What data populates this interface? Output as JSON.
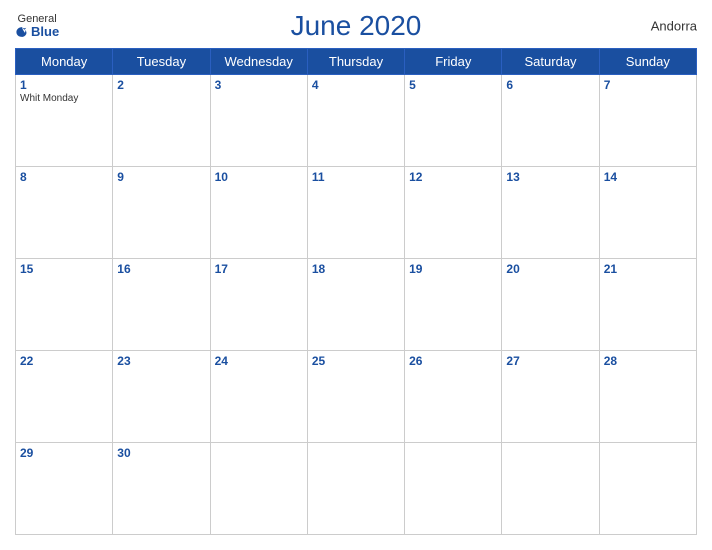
{
  "header": {
    "logo_general": "General",
    "logo_blue": "Blue",
    "title": "June 2020",
    "country": "Andorra"
  },
  "weekdays": [
    "Monday",
    "Tuesday",
    "Wednesday",
    "Thursday",
    "Friday",
    "Saturday",
    "Sunday"
  ],
  "weeks": [
    [
      {
        "day": 1,
        "holiday": "Whit Monday"
      },
      {
        "day": 2,
        "holiday": ""
      },
      {
        "day": 3,
        "holiday": ""
      },
      {
        "day": 4,
        "holiday": ""
      },
      {
        "day": 5,
        "holiday": ""
      },
      {
        "day": 6,
        "holiday": ""
      },
      {
        "day": 7,
        "holiday": ""
      }
    ],
    [
      {
        "day": 8,
        "holiday": ""
      },
      {
        "day": 9,
        "holiday": ""
      },
      {
        "day": 10,
        "holiday": ""
      },
      {
        "day": 11,
        "holiday": ""
      },
      {
        "day": 12,
        "holiday": ""
      },
      {
        "day": 13,
        "holiday": ""
      },
      {
        "day": 14,
        "holiday": ""
      }
    ],
    [
      {
        "day": 15,
        "holiday": ""
      },
      {
        "day": 16,
        "holiday": ""
      },
      {
        "day": 17,
        "holiday": ""
      },
      {
        "day": 18,
        "holiday": ""
      },
      {
        "day": 19,
        "holiday": ""
      },
      {
        "day": 20,
        "holiday": ""
      },
      {
        "day": 21,
        "holiday": ""
      }
    ],
    [
      {
        "day": 22,
        "holiday": ""
      },
      {
        "day": 23,
        "holiday": ""
      },
      {
        "day": 24,
        "holiday": ""
      },
      {
        "day": 25,
        "holiday": ""
      },
      {
        "day": 26,
        "holiday": ""
      },
      {
        "day": 27,
        "holiday": ""
      },
      {
        "day": 28,
        "holiday": ""
      }
    ],
    [
      {
        "day": 29,
        "holiday": ""
      },
      {
        "day": 30,
        "holiday": ""
      },
      {
        "day": null,
        "holiday": ""
      },
      {
        "day": null,
        "holiday": ""
      },
      {
        "day": null,
        "holiday": ""
      },
      {
        "day": null,
        "holiday": ""
      },
      {
        "day": null,
        "holiday": ""
      }
    ]
  ]
}
